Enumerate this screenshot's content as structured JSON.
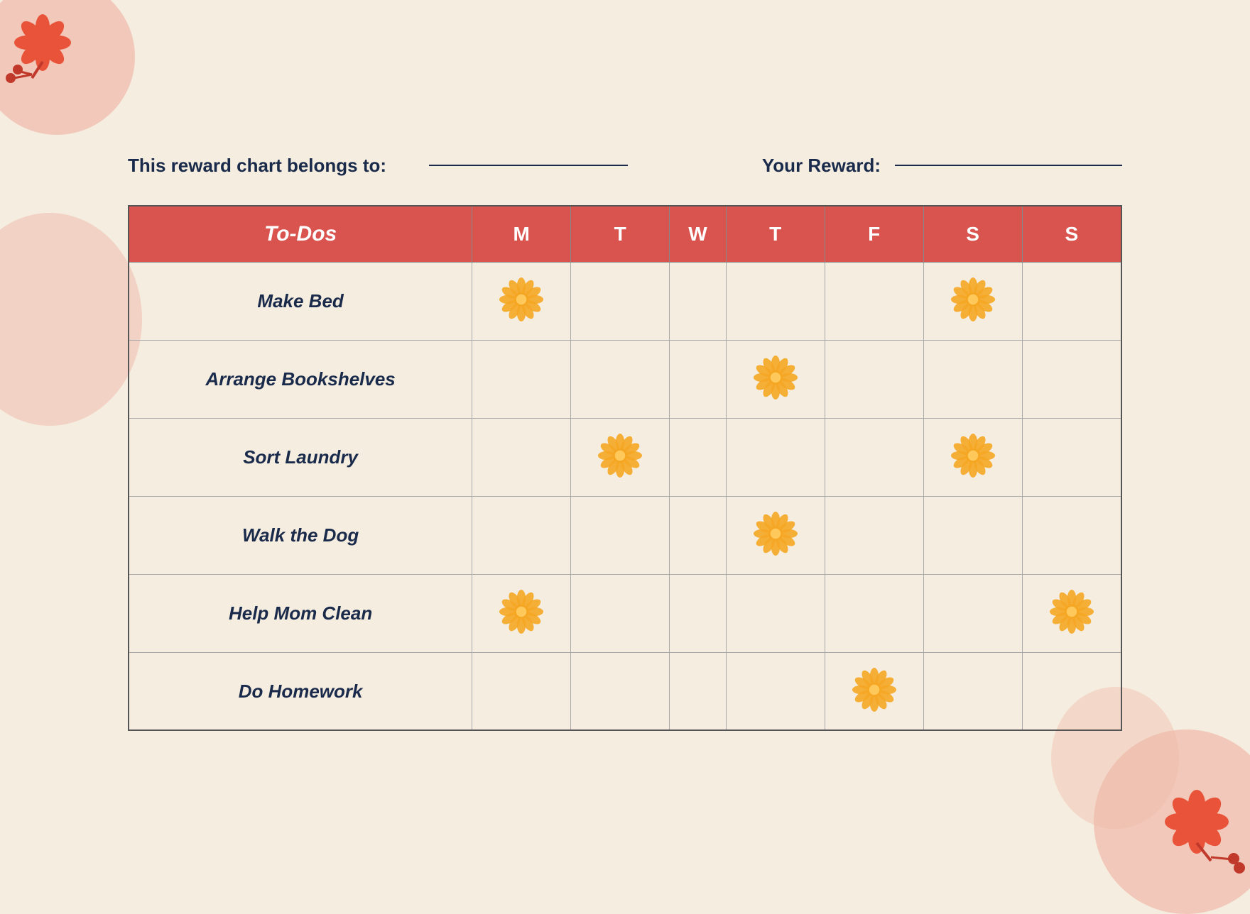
{
  "header": {
    "belongs_to_label": "This reward chart belongs to:",
    "reward_label": "Your Reward:"
  },
  "table": {
    "columns": [
      "To-Dos",
      "M",
      "T",
      "W",
      "T",
      "F",
      "S",
      "S"
    ],
    "rows": [
      {
        "task": "Make Bed",
        "days": [
          true,
          false,
          false,
          false,
          false,
          true,
          false
        ]
      },
      {
        "task": "Arrange Bookshelves",
        "days": [
          false,
          false,
          false,
          true,
          false,
          false,
          false
        ]
      },
      {
        "task": "Sort Laundry",
        "days": [
          false,
          true,
          false,
          false,
          false,
          true,
          false
        ]
      },
      {
        "task": "Walk the Dog",
        "days": [
          false,
          false,
          false,
          true,
          false,
          false,
          false
        ]
      },
      {
        "task": "Help Mom Clean",
        "days": [
          true,
          false,
          false,
          false,
          false,
          false,
          true
        ]
      },
      {
        "task": "Do Homework",
        "days": [
          false,
          false,
          false,
          false,
          true,
          false,
          false
        ]
      }
    ]
  },
  "colors": {
    "header_bg": "#d9534f",
    "bg": "#f5ede0",
    "blob": "#f0b8a8",
    "text_dark": "#1a2a4a",
    "flower_orange": "#f5a623",
    "flower_center": "#f5a623"
  }
}
